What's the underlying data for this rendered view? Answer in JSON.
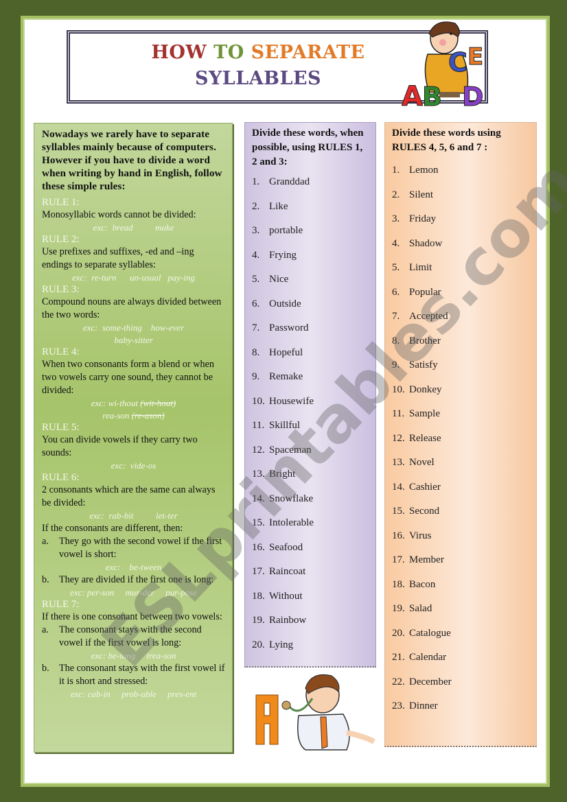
{
  "title": {
    "line1_words": [
      "HOW",
      "TO",
      "SEPARATE"
    ],
    "line2": "SYLLABLES"
  },
  "colors": {
    "frame": "#4e6329",
    "how": "#a2332f",
    "to": "#6f9336",
    "separate": "#e27b28",
    "syllables": "#5c4a82"
  },
  "illustrations": {
    "top_right": "boy-thinking-with-letters-illustration",
    "bottom_center": "doctor-with-stethoscope-letter-a-illustration"
  },
  "watermark": "ESLprintables.com",
  "rules_panel": {
    "intro": "Nowadays we rarely have to separate syllables mainly because of computers. However if you have to divide a word when writing by hand in English, follow these simple rules:",
    "rules": [
      {
        "heading": "RULE 1:",
        "text": "Monosyllabic words cannot be divided:",
        "examples": [
          "exc:  bread          make"
        ]
      },
      {
        "heading": "RULE 2:",
        "text": "Use prefixes and suffixes, -ed and –ing endings to separate syllables:",
        "examples": [
          "exc:  re-turn      un-usual   pay-ing"
        ]
      },
      {
        "heading": "RULE 3:",
        "text": "Compound nouns are always divided between the two words:",
        "examples": [
          "exc:  some-thing    how-ever",
          "baby-sitter"
        ]
      },
      {
        "heading": "RULE 4:",
        "text": "When two consonants form a blend or when two vowels carry one sound, they cannot be divided:",
        "examples_struck": [
          {
            "ok": "exc: wi-thout",
            "wrong": "(wit-hout)"
          },
          {
            "ok": "rea-son",
            "wrong": "(re-ason)"
          }
        ]
      },
      {
        "heading": "RULE 5:",
        "text": "You can divide vowels if they carry two sounds:",
        "examples": [
          "exc:  vide-os"
        ]
      },
      {
        "heading": "RULE 6:",
        "text": "2 consonants which are the same can always be divided:",
        "examples": [
          "exc:  rab-bit          let-ter"
        ],
        "followup": "If the consonants are different, then:",
        "subpoints": [
          {
            "label": "a.",
            "text": "They go with the second vowel if the first vowel is short:",
            "example": "exc:    be-tween"
          },
          {
            "label": "b.",
            "text": "They are divided if the first one is long:",
            "example": "exc: per-son     mur-der     pur-pose"
          }
        ]
      },
      {
        "heading": "RULE 7:",
        "text": "If there is one consonant between two vowels:",
        "subpoints": [
          {
            "label": "a.",
            "text": "The consonant stays with the second vowel if the first vowel is long:",
            "example": "exc: be-long     trea-son"
          },
          {
            "label": "b.",
            "text": "The consonant stays with the first vowel if it is short and stressed:",
            "example": "exc: cab-in     prob-able     pres-ent"
          }
        ]
      }
    ]
  },
  "list1": {
    "heading": "Divide these words, when possible, using RULES  1, 2 and 3:",
    "items": [
      "Granddad",
      "Like",
      "portable",
      "Frying",
      "Nice",
      "Outside",
      "Password",
      "Hopeful",
      "Remake",
      "Housewife",
      "Skillful",
      "Spaceman",
      "Bright",
      "Snowflake",
      "Intolerable",
      "Seafood",
      "Raincoat",
      "Without",
      "Rainbow",
      "Lying"
    ]
  },
  "list2": {
    "heading": "Divide these words using RULES 4, 5, 6 and 7 :",
    "items": [
      "Lemon",
      "Silent",
      "Friday",
      "Shadow",
      "Limit",
      "Popular",
      "Accepted",
      "Brother",
      "Satisfy",
      "Donkey",
      "Sample",
      "Release",
      "Novel",
      "Cashier",
      "Second",
      "Virus",
      "Member",
      "Bacon",
      "Salad",
      "Catalogue",
      "Calendar",
      "December",
      "Dinner"
    ]
  }
}
